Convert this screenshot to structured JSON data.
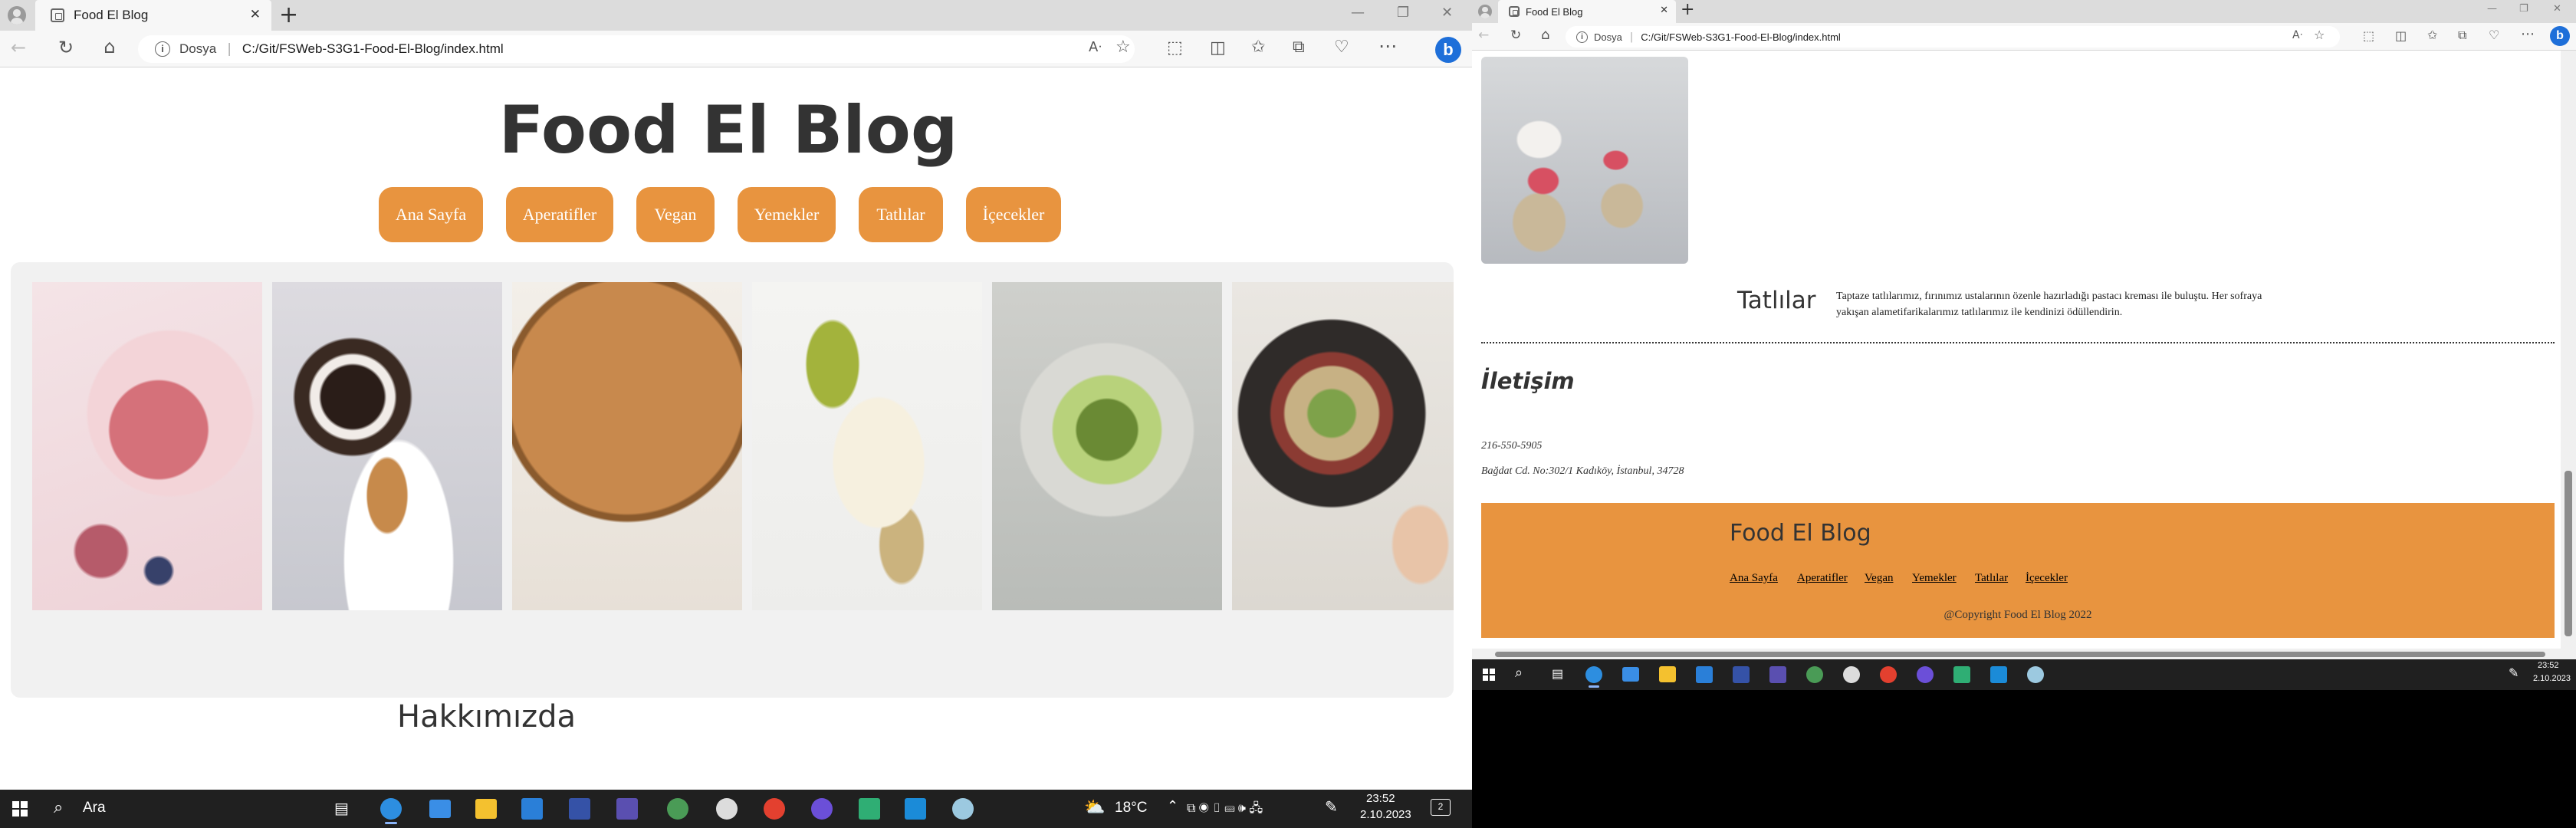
{
  "browser": {
    "tab_title": "Food El Blog",
    "new_tab": "+",
    "close_tab": "✕",
    "address_label": "Dosya",
    "address_sep": "|",
    "url": "C:/Git/FSWeb-S3G1-Food-El-Blog/index.html",
    "window_controls": [
      "—",
      "❐",
      "✕"
    ],
    "icons": [
      "back-icon",
      "refresh-icon",
      "home-icon",
      "read-aloud-icon",
      "favorite-star-icon",
      "extensions-icon",
      "split-screen-icon",
      "favorites-icon",
      "collections-icon",
      "browser-essentials-icon",
      "more-icon",
      "bing-copilot-icon"
    ],
    "bing_label": "b"
  },
  "site": {
    "title": "Food El Blog",
    "nav": [
      "Ana Sayfa",
      "Aperatifler",
      "Vegan",
      "Yemekler",
      "Tatlılar",
      "İçecekler"
    ],
    "gallery": [
      "chia-pudding-photo",
      "cake-roll-photo",
      "pie-photo",
      "pear-dessert-photo",
      "salad-photo",
      "bowl-photo"
    ],
    "about_title": "Hakkımızda"
  },
  "right_page": {
    "section_title": "Tatlılar",
    "section_text": "Taptaze tatlılarımız, fırınımız ustalarının özenle hazırladığı pastacı kreması ile buluştu. Her sofraya yakışan alametifarikalarımız tatlılarımız ile kendinizi ödüllendirin.",
    "contact_title": "İletişim",
    "phone": "216-550-5905",
    "address": "Bağdat Cd. No:302/1 Kadıköy, İstanbul, 34728",
    "footer_title": "Food El Blog",
    "footer_links": [
      "Ana Sayfa",
      "Aperatifler",
      "Vegan",
      "Yemekler",
      "Tatlılar",
      "İçecekler"
    ],
    "copyright": "@Copyright Food El Blog 2022"
  },
  "taskbar_left": {
    "search": "Ara",
    "weather": "18°C",
    "time": "23:52",
    "date": "2.10.2023",
    "notif": "2"
  },
  "taskbar_right": {
    "time": "23:52",
    "date": "2.10.2023"
  },
  "colors": {
    "accent": "#e8943f",
    "taskbar": "#202020",
    "chrome": "#f7f7f7"
  }
}
